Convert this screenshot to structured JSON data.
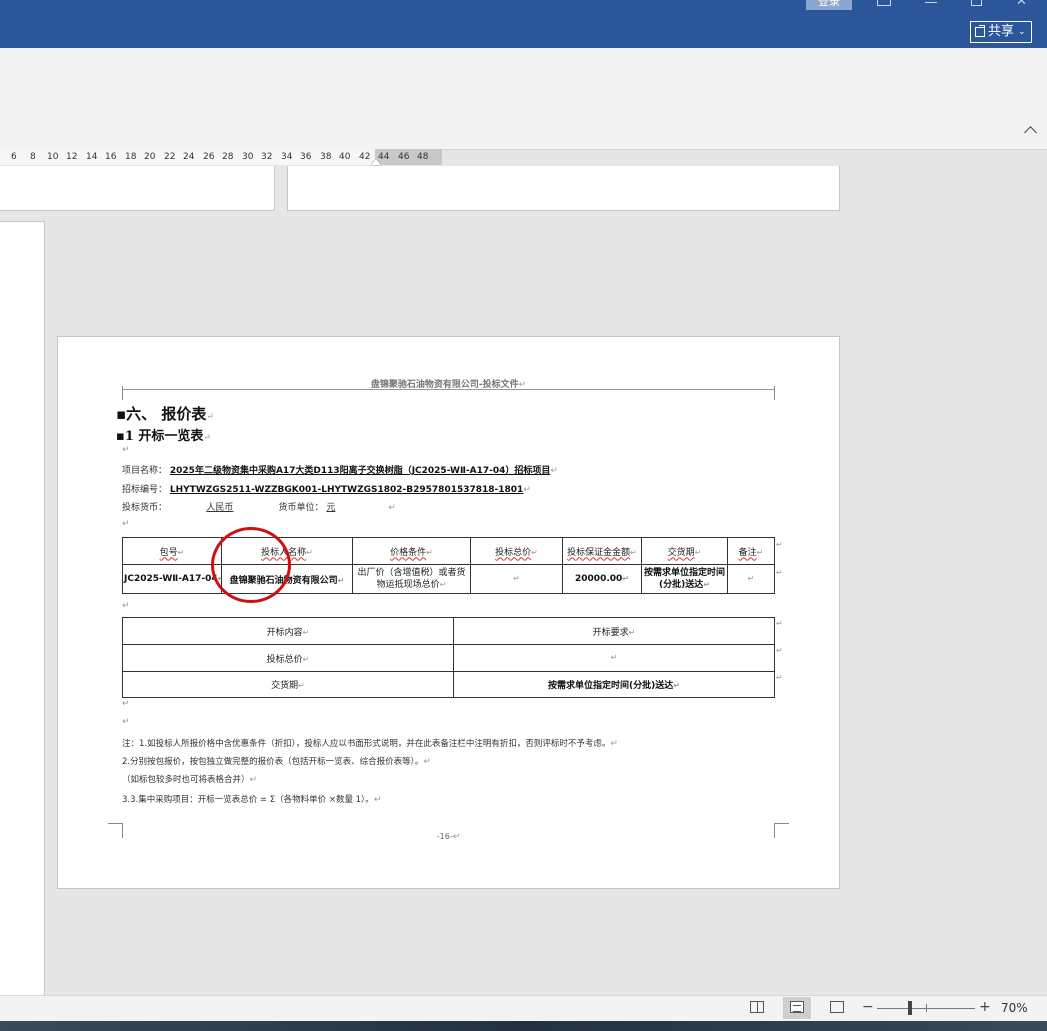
{
  "titlebar": {
    "login": "登录",
    "share": "共享"
  },
  "ruler": {
    "ticks": [
      "6",
      "8",
      "10",
      "12",
      "14",
      "16",
      "18",
      "20",
      "22",
      "24",
      "26",
      "28",
      "30",
      "32",
      "34",
      "36",
      "38",
      "40",
      "42",
      "44",
      "46",
      "48"
    ]
  },
  "document": {
    "header": "盘锦聚驰石油物资有限公司-投标文件",
    "section_title": "六、 报价表",
    "subsection_title": "1 开标一览表",
    "project_name_label": "项目名称：",
    "project_name": "2025年二级物资集中采购A17大类D113阳离子交换树脂（JC2025-WⅡ-A17-04）招标项目",
    "bid_number_label": "招标编号：",
    "bid_number": "LHYTWZGS2511-WZZBGK001-LHYTWZGS1802-B2957801537818-1801",
    "currency_label": "投标货币：",
    "currency": "人民币",
    "unit_label": "货币单位：",
    "unit": "元",
    "table1": {
      "headers": [
        "包号",
        "投标人名称",
        "价格条件",
        "投标总价",
        "投标保证金金额",
        "交货期",
        "备注"
      ],
      "row": [
        "JC2025-WⅡ-A17-04",
        "盘锦聚驰石油物资有限公司",
        "出厂价（含增值税）或者货物运抵现场总价",
        "",
        "20000.00",
        "按需求单位指定时间(分批)送达",
        ""
      ]
    },
    "table2": {
      "rows": [
        [
          "开标内容",
          "开标要求"
        ],
        [
          "投标总价",
          ""
        ],
        [
          "交货期",
          "按需求单位指定时间(分批)送达"
        ]
      ]
    },
    "notes": [
      "注：1.如投标人所报价格中含优惠条件（折扣），投标人应以书面形式说明，并在此表备注栏中注明有折扣，否则评标时不予考虑。",
      "2.分别按包报价，按包独立做完整的报价表（包括开标一览表、综合报价表等）。",
      "（如标包较多时也可将表格合并）",
      "3.3.集中采购项目：开标一览表总价 = Σ（各物料单价 ×数量 1）。"
    ],
    "page_number": "-16-",
    "para_mark": "↵"
  },
  "statusbar": {
    "zoom": "70%"
  }
}
